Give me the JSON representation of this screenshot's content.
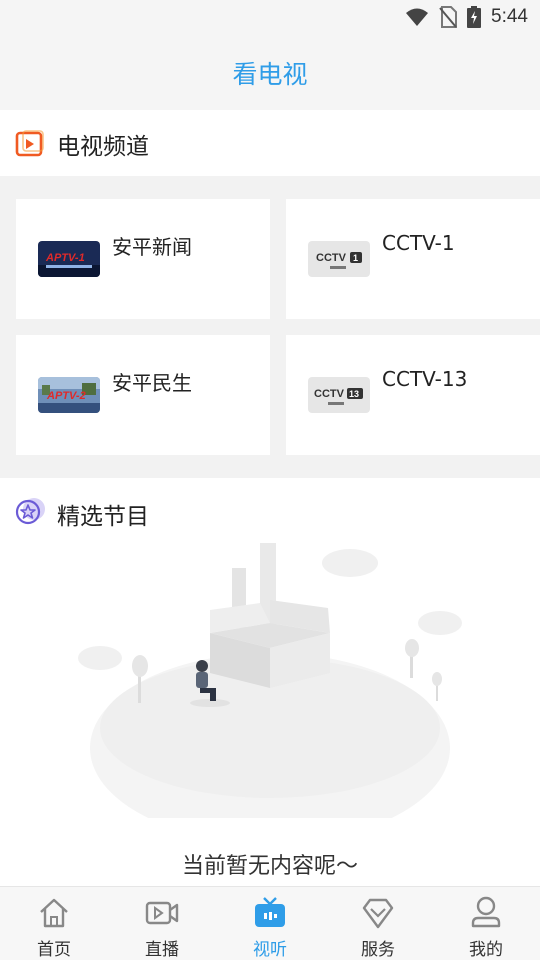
{
  "status": {
    "time": "5:44"
  },
  "header": {
    "title": "看电视"
  },
  "tv_section": {
    "title": "电视频道"
  },
  "channels": [
    {
      "name": "安平新闻",
      "logo": "aptv-news-logo"
    },
    {
      "name": "CCTV-1",
      "logo": "cctv1-logo"
    },
    {
      "name": "安平民生",
      "logo": "aptv-minsheng-logo"
    },
    {
      "name": "CCTV-13",
      "logo": "cctv13-logo"
    }
  ],
  "featured": {
    "title": "精选节目",
    "empty_text": "当前暂无内容呢～"
  },
  "tabs": [
    {
      "label": "首页",
      "icon": "home-icon"
    },
    {
      "label": "直播",
      "icon": "live-video-icon"
    },
    {
      "label": "视听",
      "icon": "tv-icon"
    },
    {
      "label": "服务",
      "icon": "diamond-icon"
    },
    {
      "label": "我的",
      "icon": "user-icon"
    }
  ],
  "colors": {
    "accent": "#2f9de8",
    "section_icon": "#f05a22",
    "featured_icon": "#6b5bd6"
  }
}
